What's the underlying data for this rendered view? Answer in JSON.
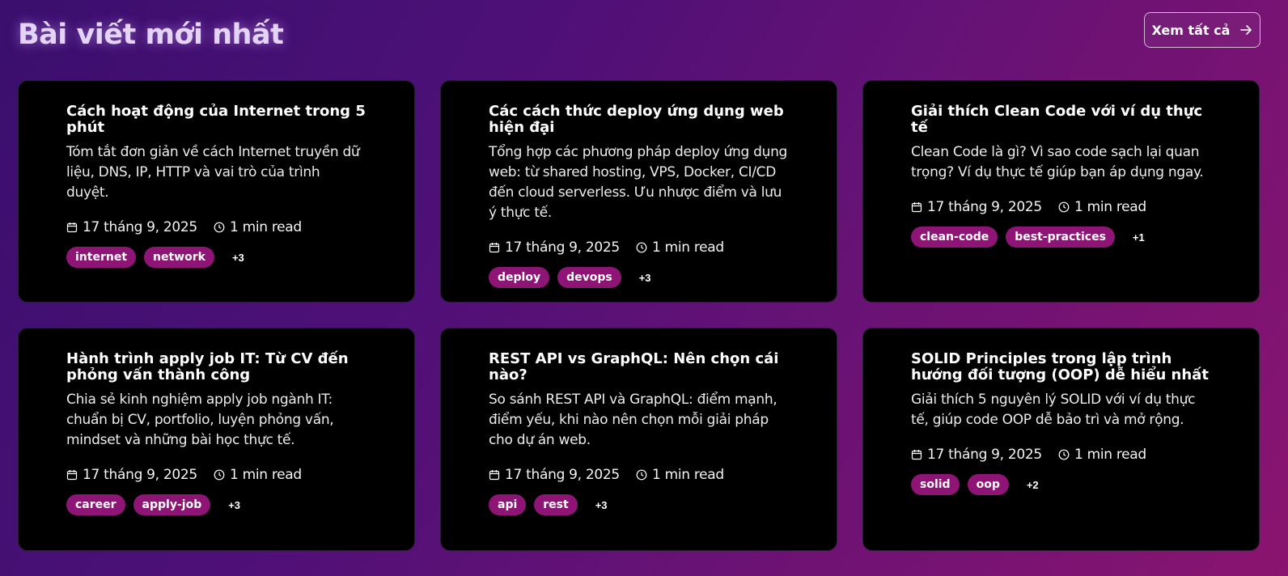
{
  "header": {
    "title": "Bài viết mới nhất",
    "view_all_label": "Xem tất cả"
  },
  "icons": {
    "arrow": "arrow-right-icon",
    "date": "calendar-icon",
    "time": "clock-icon"
  },
  "colors": {
    "tag_bg": "#8e1476",
    "card_bg": "#000000",
    "title_glow": "#e4d4f7"
  },
  "posts": [
    {
      "title": "Cách hoạt động của Internet trong 5 phút",
      "desc": "Tóm tắt đơn giản về cách Internet truyền dữ liệu, DNS, IP, HTTP và vai trò của trình duyệt.",
      "date": "17 tháng 9, 2025",
      "read": "1 min read",
      "tags": [
        "internet",
        "network"
      ],
      "more": "+3"
    },
    {
      "title": "Các cách thức deploy ứng dụng web hiện đại",
      "desc": "Tổng hợp các phương pháp deploy ứng dụng web: từ shared hosting, VPS, Docker, CI/CD đến cloud serverless. Ưu nhược điểm và lưu ý thực tế.",
      "date": "17 tháng 9, 2025",
      "read": "1 min read",
      "tags": [
        "deploy",
        "devops"
      ],
      "more": "+3"
    },
    {
      "title": "Giải thích Clean Code với ví dụ thực tế",
      "desc": "Clean Code là gì? Vì sao code sạch lại quan trọng? Ví dụ thực tế giúp bạn áp dụng ngay.",
      "date": "17 tháng 9, 2025",
      "read": "1 min read",
      "tags": [
        "clean-code",
        "best-practices"
      ],
      "more": "+1"
    },
    {
      "title": "Hành trình apply job IT: Từ CV đến phỏng vấn thành công",
      "desc": "Chia sẻ kinh nghiệm apply job ngành IT: chuẩn bị CV, portfolio, luyện phỏng vấn, mindset và những bài học thực tế.",
      "date": "17 tháng 9, 2025",
      "read": "1 min read",
      "tags": [
        "career",
        "apply-job"
      ],
      "more": "+3"
    },
    {
      "title": "REST API vs GraphQL: Nên chọn cái nào?",
      "desc": "So sánh REST API và GraphQL: điểm mạnh, điểm yếu, khi nào nên chọn mỗi giải pháp cho dự án web.",
      "date": "17 tháng 9, 2025",
      "read": "1 min read",
      "tags": [
        "api",
        "rest"
      ],
      "more": "+3"
    },
    {
      "title": "SOLID Principles trong lập trình hướng đối tượng (OOP) dễ hiểu nhất",
      "desc": "Giải thích 5 nguyên lý SOLID với ví dụ thực tế, giúp code OOP dễ bảo trì và mở rộng.",
      "date": "17 tháng 9, 2025",
      "read": "1 min read",
      "tags": [
        "solid",
        "oop"
      ],
      "more": "+2"
    }
  ]
}
